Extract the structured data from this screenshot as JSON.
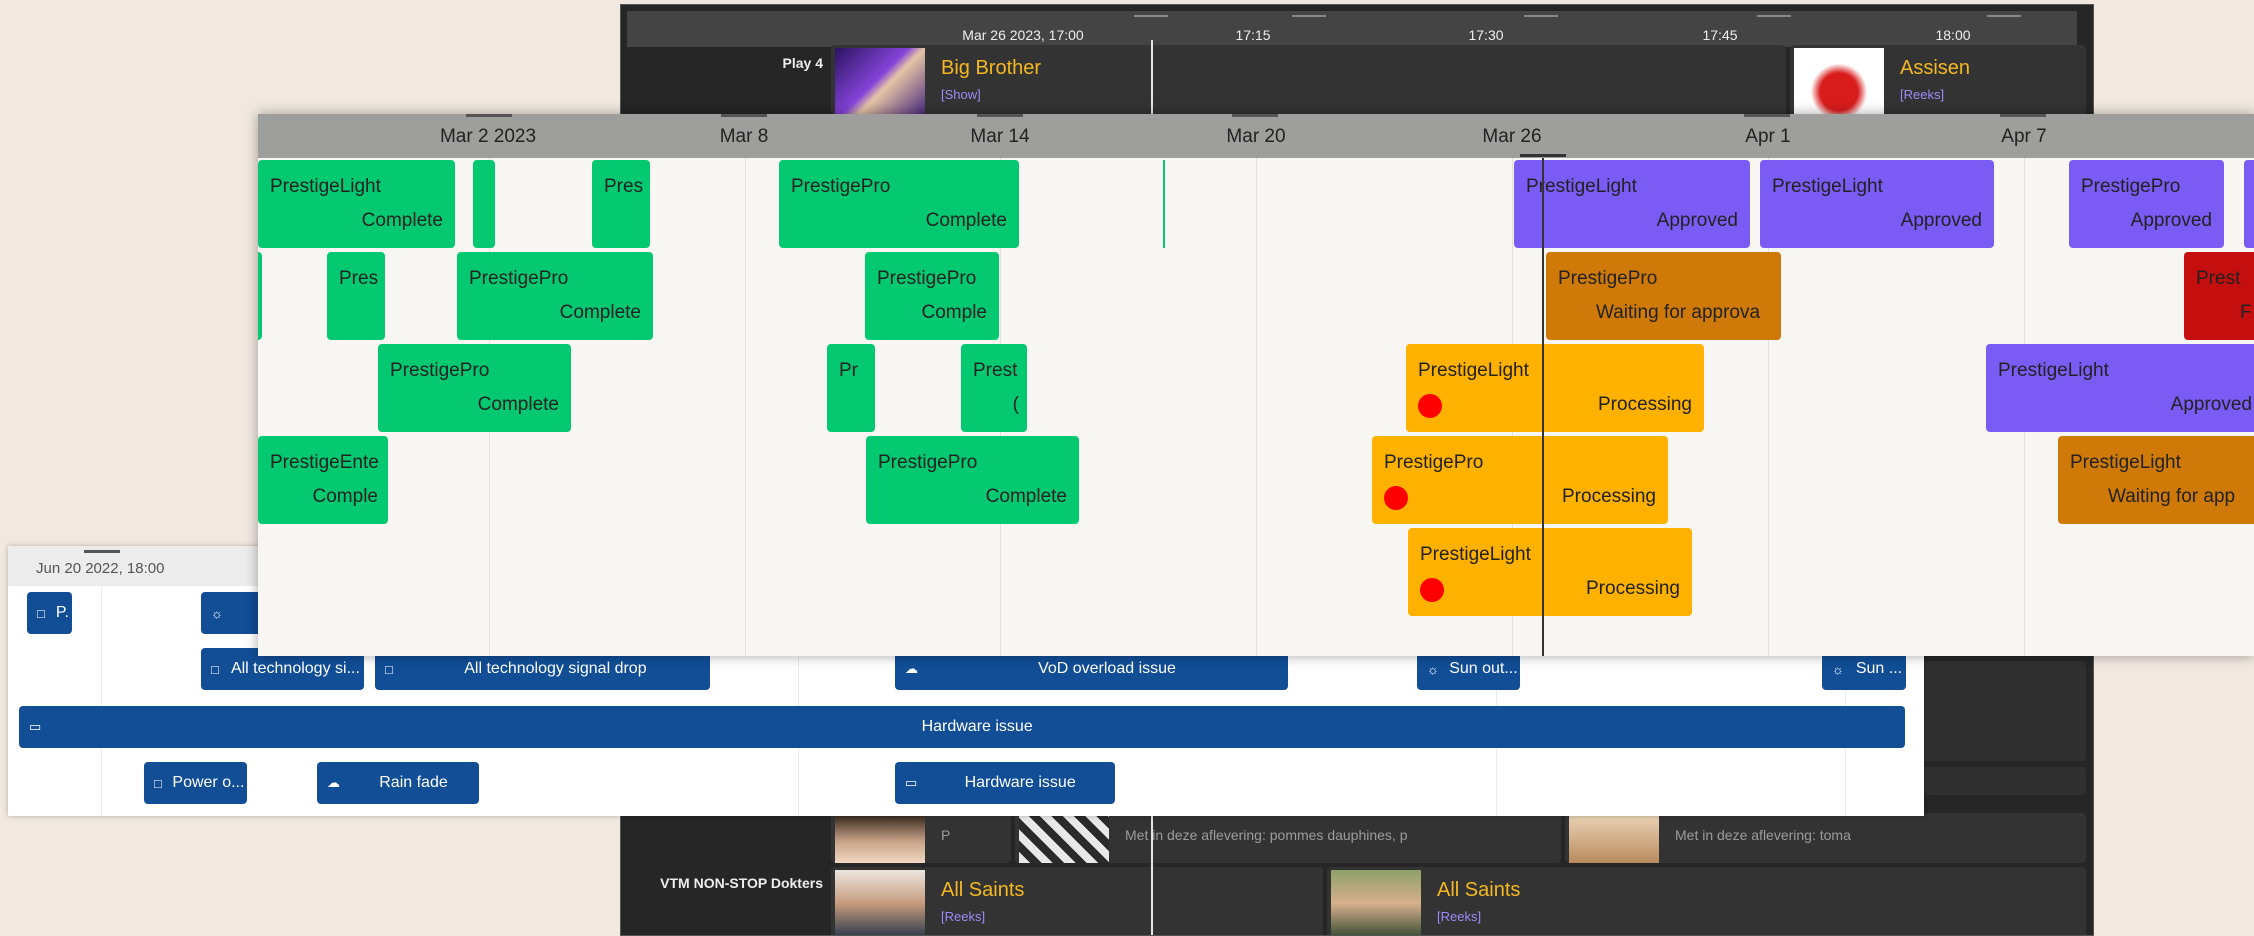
{
  "tv_guide": {
    "ticks": [
      "Mar 26 2023, 17:00",
      "17:15",
      "17:30",
      "17:45",
      "18:00"
    ],
    "channels": [
      {
        "name": "Play 4"
      },
      {
        "name": "VTM NON-STOP Dokters"
      }
    ],
    "programs": [
      {
        "title": "Big Brother",
        "genre": "[Show]"
      },
      {
        "title": "Assisen",
        "genre": "[Reeks]"
      },
      {
        "title": "All Saints",
        "genre": "[Reeks]"
      },
      {
        "title": "All Saints",
        "genre": "[Reeks]"
      }
    ],
    "descriptions": [
      "P",
      "Met in deze aflevering: pommes dauphines, p",
      "Met in deze aflevering: toma"
    ]
  },
  "issues": {
    "header_date": "Jun 20 2022, 18:00",
    "bars": [
      {
        "label": "P.",
        "icon": "document-icon"
      },
      {
        "label": "",
        "icon": "weather-icon"
      },
      {
        "label": "All technology si...",
        "icon": "document-icon"
      },
      {
        "label": "All technology signal drop",
        "icon": "document-icon"
      },
      {
        "label": "VoD overload issue",
        "icon": "cloud-icon"
      },
      {
        "label": "Sun out...",
        "icon": "weather-icon"
      },
      {
        "label": "Sun ...",
        "icon": "weather-icon"
      },
      {
        "label": "Hardware issue",
        "icon": "hardware-icon"
      },
      {
        "label": "Power o...",
        "icon": "document-icon"
      },
      {
        "label": "Rain fade",
        "icon": "cloud-icon"
      },
      {
        "label": "Hardware issue",
        "icon": "hardware-icon"
      }
    ]
  },
  "scheduler": {
    "ticks": [
      "Mar 2 2023",
      "Mar 8",
      "Mar 14",
      "Mar 20",
      "Mar 26",
      "Apr 1",
      "Apr 7"
    ],
    "jobs": [
      {
        "name": "PrestigeLight",
        "status": "Complete",
        "color": "#04c971"
      },
      {
        "name": "",
        "status": "",
        "color": "#04c971"
      },
      {
        "name": "Pres",
        "status": "",
        "color": "#04c971"
      },
      {
        "name": "PrestigePro",
        "status": "Complete",
        "color": "#04c971"
      },
      {
        "name": "PrestigeLight",
        "status": "Approved",
        "color": "#7a5cf5"
      },
      {
        "name": "PrestigeLight",
        "status": "Approved",
        "color": "#7a5cf5"
      },
      {
        "name": "PrestigePro",
        "status": "Approved",
        "color": "#7a5cf5"
      },
      {
        "name": "",
        "status": "",
        "color": "#7a5cf5"
      },
      {
        "name": "",
        "status": "",
        "color": "#04c971"
      },
      {
        "name": "Pres",
        "status": "",
        "color": "#04c971"
      },
      {
        "name": "PrestigePro",
        "status": "Complete",
        "color": "#04c971"
      },
      {
        "name": "PrestigePro",
        "status": "Comple",
        "color": "#04c971"
      },
      {
        "name": "PrestigePro",
        "status": "Waiting for approva",
        "color": "#cf7a08"
      },
      {
        "name": "Prest",
        "status": "F",
        "color": "#c50e0e"
      },
      {
        "name": "PrestigePro",
        "status": "Complete",
        "color": "#04c971"
      },
      {
        "name": "Pr",
        "status": "",
        "color": "#04c971"
      },
      {
        "name": "Prest",
        "status": "(",
        "color": "#04c971"
      },
      {
        "name": "PrestigeLight",
        "status": "Processing",
        "color": "#ffb100"
      },
      {
        "name": "PrestigeLight",
        "status": "Approved",
        "color": "#7a5cf5"
      },
      {
        "name": "PrestigeEnte",
        "status": "Comple",
        "color": "#04c971"
      },
      {
        "name": "PrestigePro",
        "status": "Complete",
        "color": "#04c971"
      },
      {
        "name": "PrestigePro",
        "status": "Processing",
        "color": "#ffb100"
      },
      {
        "name": "PrestigeLight",
        "status": "Waiting for app",
        "color": "#cf7a08"
      },
      {
        "name": "PrestigeLight",
        "status": "Processing",
        "color": "#ffb100"
      }
    ]
  }
}
